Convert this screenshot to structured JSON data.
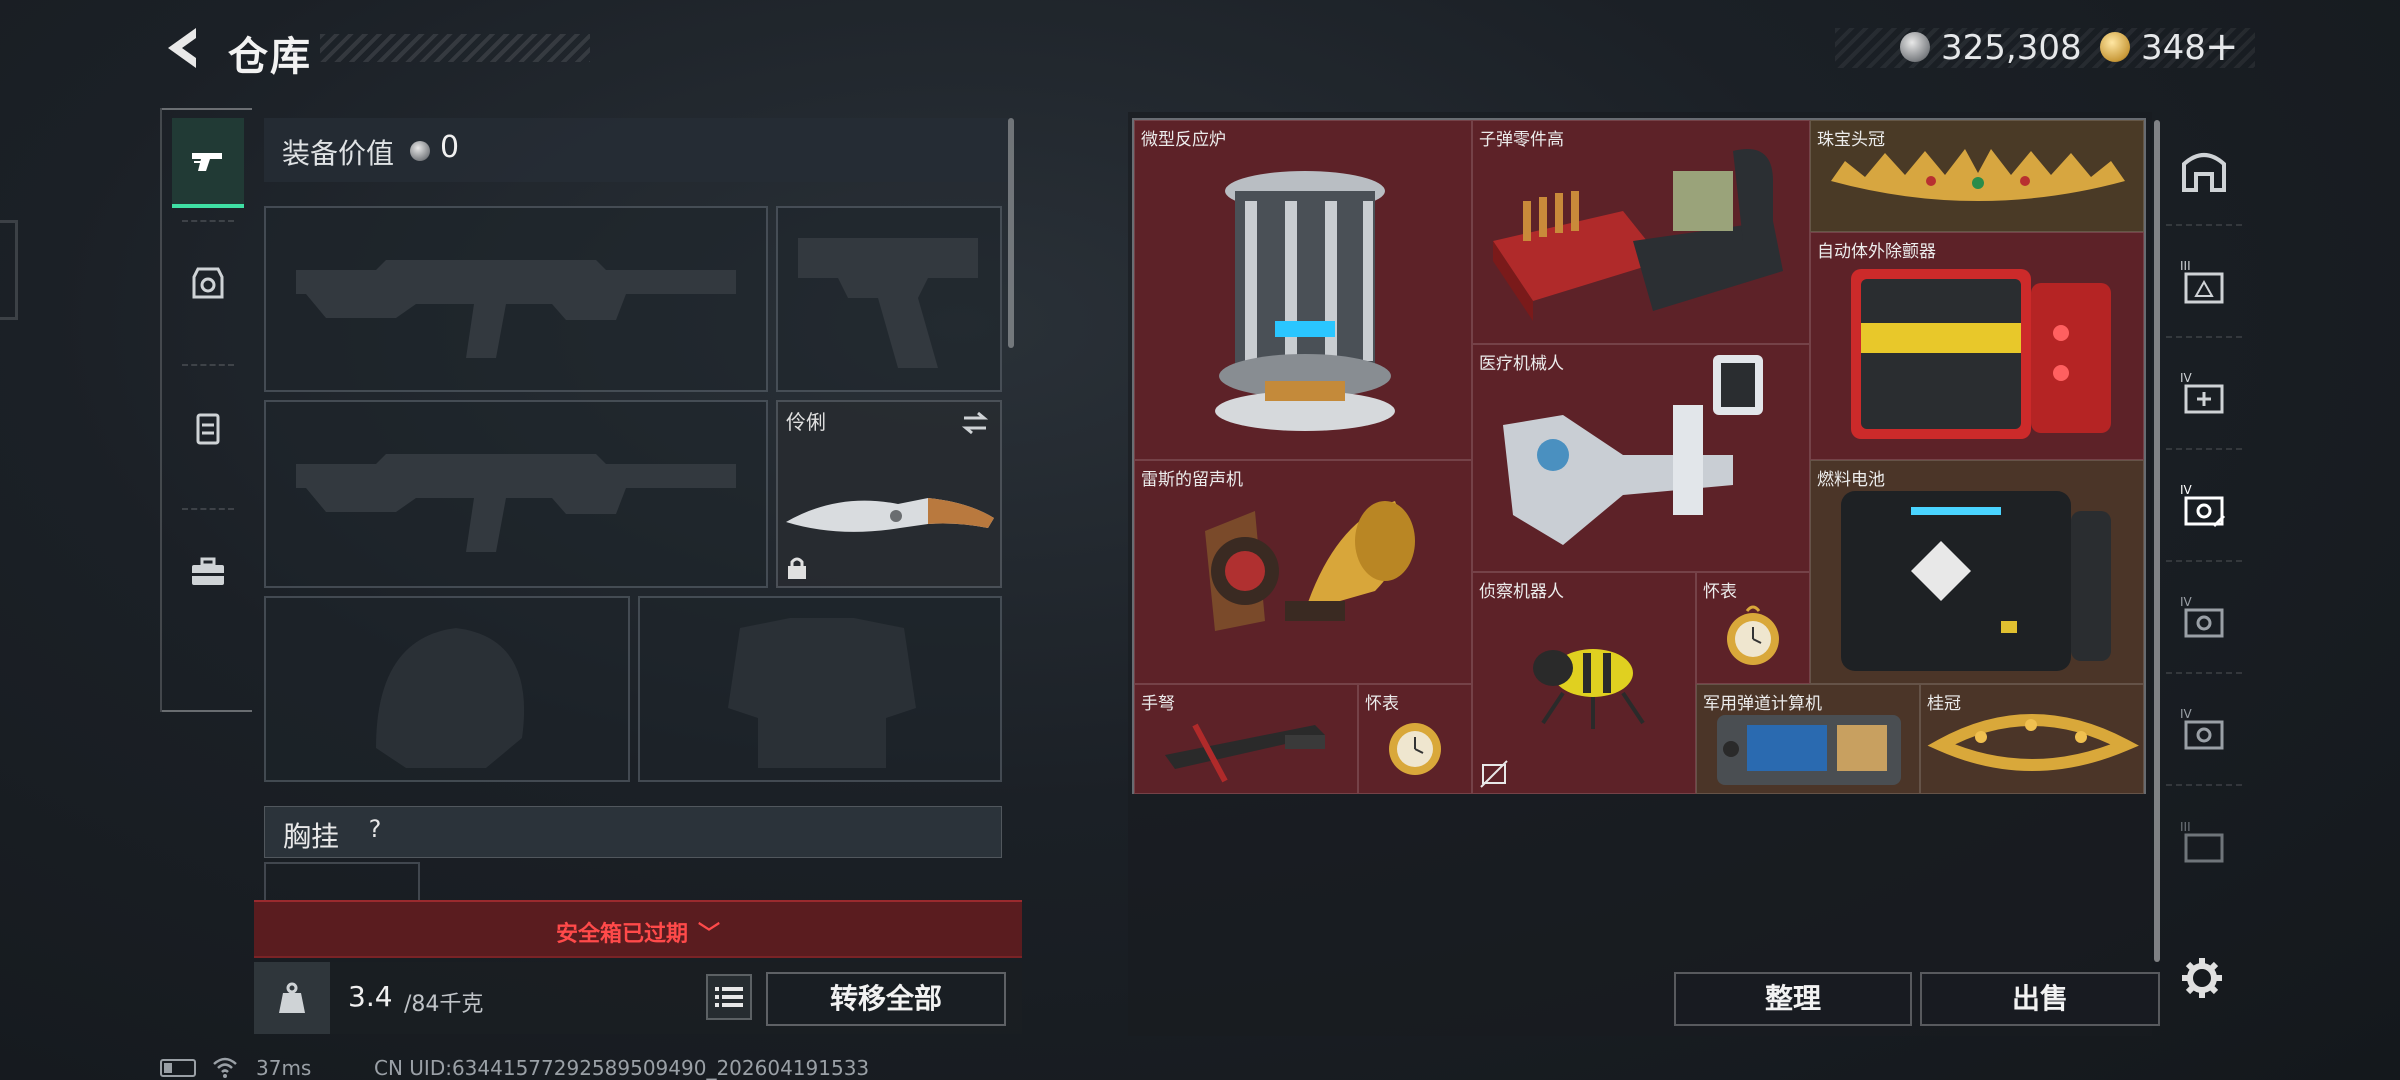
{
  "header": {
    "title": "仓库",
    "currency": {
      "silver": "325,308",
      "gold": "348",
      "gold_add": "+"
    }
  },
  "left_rail": {
    "tabs": [
      {
        "name": "weapons",
        "icon": "pistol-icon",
        "active": true
      },
      {
        "name": "armor",
        "icon": "helmet-icon",
        "active": false
      },
      {
        "name": "backpack",
        "icon": "backpack-icon",
        "active": false
      },
      {
        "name": "tools",
        "icon": "toolbox-icon",
        "active": false
      }
    ]
  },
  "equipment": {
    "value_label": "装备价值",
    "value": "0",
    "melee_name": "伶俐",
    "chest_rig_label": "胸挂",
    "chest_rig_help": "?"
  },
  "safebox": {
    "message": "安全箱已过期"
  },
  "inventory_footer": {
    "weight_current": "3.4",
    "weight_max": "/84千克",
    "transfer_all": "转移全部"
  },
  "stash": {
    "items": [
      {
        "name": "微型反应炉",
        "rarity": "red"
      },
      {
        "name": "子弹零件高",
        "rarity": "red"
      },
      {
        "name": "珠宝头冠",
        "rarity": "gold"
      },
      {
        "name": "自动体外除颤器",
        "rarity": "red"
      },
      {
        "name": "医疗机械人",
        "rarity": "red"
      },
      {
        "name": "雷斯的留声机",
        "rarity": "red"
      },
      {
        "name": "燃料电池",
        "rarity": "brown"
      },
      {
        "name": "侦察机器人",
        "rarity": "red"
      },
      {
        "name": "怀表",
        "rarity": "red"
      },
      {
        "name": "手弩",
        "rarity": "red"
      },
      {
        "name": "怀表",
        "rarity": "red"
      },
      {
        "name": "军用弹道计算机",
        "rarity": "brown"
      },
      {
        "name": "桂冠",
        "rarity": "brown"
      }
    ],
    "sort_label": "整理",
    "sell_label": "出售"
  },
  "right_rail": {
    "tabs": [
      {
        "icon": "stash-home-icon"
      },
      {
        "icon": "container-tier-icon",
        "tier": "III"
      },
      {
        "icon": "medical-container-icon",
        "tier": "IV"
      },
      {
        "icon": "container-tier-icon",
        "tier": "IV"
      },
      {
        "icon": "container-tier-icon",
        "tier": "IV"
      },
      {
        "icon": "container-tier-icon",
        "tier": "IV"
      },
      {
        "icon": "container-tier-icon",
        "tier": "III"
      }
    ]
  },
  "status": {
    "ping": "37ms",
    "uid": "CN UID:6344157729258950949​0_202604191533"
  },
  "colors": {
    "accent_green": "#3fe0a4",
    "rarity_red": "#5d2228",
    "rarity_brown": "#4b3528",
    "warning_red": "#ff4a4a"
  }
}
